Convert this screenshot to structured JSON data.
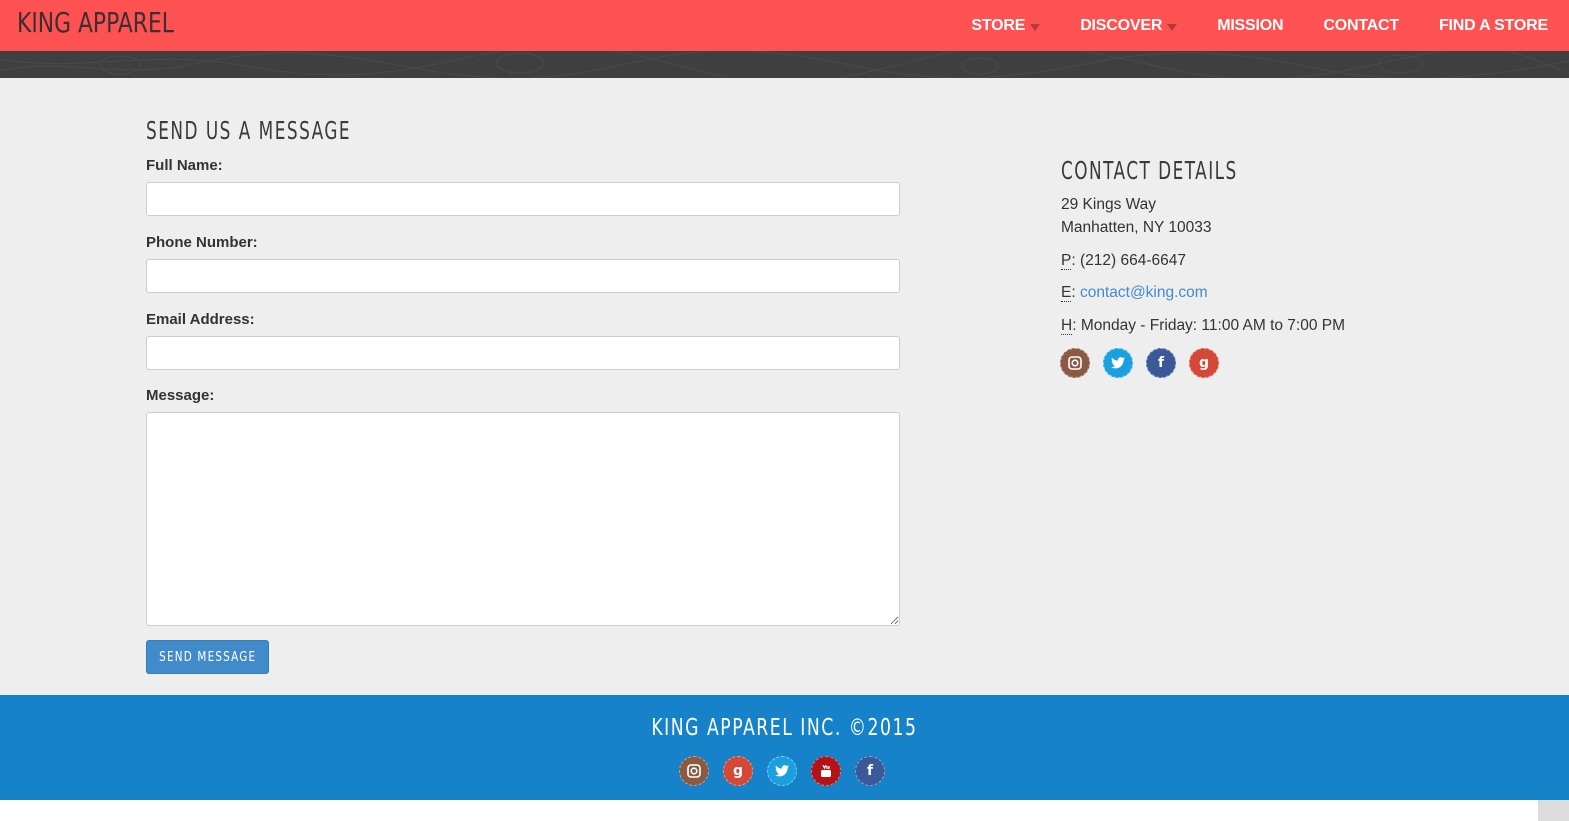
{
  "navbar": {
    "brand": "KING APPAREL",
    "items": [
      {
        "label": "STORE",
        "dropdown": true
      },
      {
        "label": "DISCOVER",
        "dropdown": true
      },
      {
        "label": "MISSION",
        "dropdown": false
      },
      {
        "label": "CONTACT",
        "dropdown": false
      },
      {
        "label": "FIND A STORE",
        "dropdown": false
      }
    ]
  },
  "form": {
    "title": "SEND US A MESSAGE",
    "full_name_label": "Full Name:",
    "full_name_value": "",
    "phone_label": "Phone Number:",
    "phone_value": "",
    "email_label": "Email Address:",
    "email_value": "",
    "message_label": "Message:",
    "message_value": "",
    "submit_label": "SEND MESSAGE"
  },
  "contact": {
    "title": "CONTACT DETAILS",
    "address_line1": "29 Kings Way",
    "address_line2": "Manhatten, NY 10033",
    "phone_prefix": "P",
    "phone": "(212) 664-6647",
    "email_prefix": "E",
    "email": "contact@king.com",
    "hours_prefix": "H",
    "hours": "Monday - Friday: 11:00 AM to 7:00 PM",
    "social": [
      "instagram-icon",
      "twitter-icon",
      "facebook-icon",
      "google-plus-icon"
    ]
  },
  "footer": {
    "copyright": "KING APPAREL INC. ©2015",
    "social": [
      "instagram-icon",
      "google-plus-icon",
      "twitter-icon",
      "youtube-icon",
      "facebook-icon"
    ]
  },
  "colors": {
    "navbar": "#fe5252",
    "band": "#3f3f3f",
    "main_bg": "#eeeeee",
    "footer": "#1582ca",
    "button": "#428bca",
    "link": "#428bca"
  }
}
